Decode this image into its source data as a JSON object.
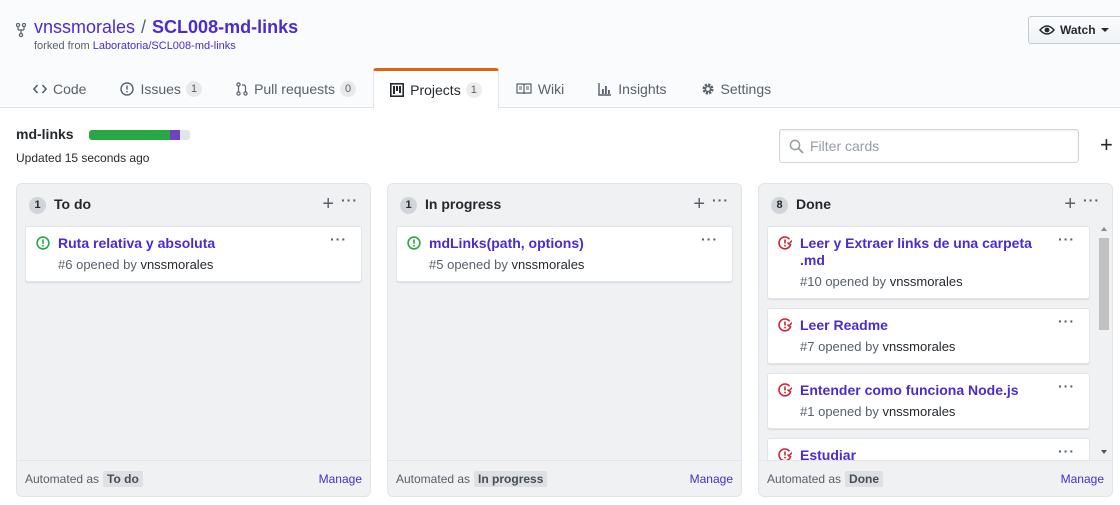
{
  "repo": {
    "owner": "vnssmorales",
    "separator": "/",
    "name": "SCL008-md-links",
    "forked_prefix": "forked from",
    "forked_source": "Laboratoria/SCL008-md-links"
  },
  "watch": {
    "label": "Watch"
  },
  "tabs": [
    {
      "label": "Code",
      "icon": "code-icon",
      "counter": null
    },
    {
      "label": "Issues",
      "icon": "issue-icon",
      "counter": "1"
    },
    {
      "label": "Pull requests",
      "icon": "pull-request-icon",
      "counter": "0"
    },
    {
      "label": "Projects",
      "icon": "project-icon",
      "counter": "1",
      "selected": true
    },
    {
      "label": "Wiki",
      "icon": "book-icon",
      "counter": null
    },
    {
      "label": "Insights",
      "icon": "graph-icon",
      "counter": null
    },
    {
      "label": "Settings",
      "icon": "gear-icon",
      "counter": null
    }
  ],
  "project": {
    "name": "md-links",
    "updated": "Updated 15 seconds ago",
    "progress": {
      "done_fraction": 0.8,
      "in_progress_fraction": 0.1,
      "done_color": "#28a745",
      "in_progress_color": "#6f42c1"
    },
    "filter_placeholder": "Filter cards",
    "add_column_label": "+"
  },
  "colors": {
    "link": "#4b2bd1",
    "accent_tab": "#e36209",
    "open_issue": "#28a745",
    "closed_issue": "#cb2431"
  },
  "columns": [
    {
      "count": "1",
      "name": "To do",
      "automation_prefix": "Automated as",
      "automation_value": "To do",
      "manage": "Manage",
      "cards": [
        {
          "title": "Ruta relativa y absoluta",
          "number": "#6",
          "opened_by": "opened by",
          "author": "vnssmorales",
          "state": "open"
        }
      ]
    },
    {
      "count": "1",
      "name": "In progress",
      "automation_prefix": "Automated as",
      "automation_value": "In progress",
      "manage": "Manage",
      "cards": [
        {
          "title": "mdLinks(path, options)",
          "number": "#5",
          "opened_by": "opened by",
          "author": "vnssmorales",
          "state": "open"
        }
      ]
    },
    {
      "count": "8",
      "name": "Done",
      "automation_prefix": "Automated as",
      "automation_value": "Done",
      "manage": "Manage",
      "cards": [
        {
          "title": "Leer y Extraer links de una carpeta .md",
          "number": "#10",
          "opened_by": "opened by",
          "author": "vnssmorales",
          "state": "closed"
        },
        {
          "title": "Leer Readme",
          "number": "#7",
          "opened_by": "opened by",
          "author": "vnssmorales",
          "state": "closed"
        },
        {
          "title": "Entender como funciona Node.js",
          "number": "#1",
          "opened_by": "opened by",
          "author": "vnssmorales",
          "state": "closed"
        },
        {
          "title": "Estudiar",
          "number": "",
          "opened_by": "",
          "author": "",
          "state": "closed"
        }
      ]
    }
  ]
}
